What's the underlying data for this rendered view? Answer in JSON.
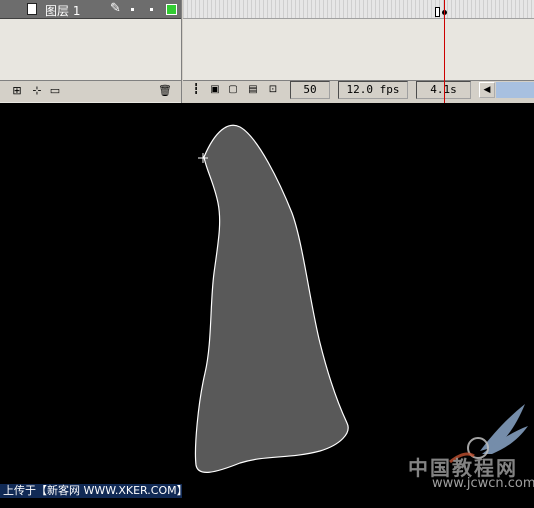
{
  "layer": {
    "name": "图层 1",
    "color": "#33cc33"
  },
  "status": {
    "current_frame": "50",
    "frame_rate": "12.0 fps",
    "elapsed_time": "4.1s"
  },
  "watermark": {
    "text": "上传于【新客网 WWW.XKER.COM】"
  },
  "logo": {
    "text_cn": "中国教程网",
    "url": "www.jcwcn.com"
  },
  "icons": {
    "insert_layer": "add-layer-icon",
    "motion_guide": "motion-guide-icon",
    "insert_folder": "folder-icon",
    "delete": "trash-icon",
    "center_frame": "center-frame-icon",
    "onion_skin": "onion-skin-icon",
    "onion_outline": "onion-outline-icon",
    "edit_multiple": "edit-multiple-frames-icon",
    "onion_markers": "onion-markers-icon"
  },
  "colors": {
    "stage_background": "#000000",
    "shape_fill": "#595959",
    "shape_stroke": "#ffffff",
    "playhead": "#cc0000",
    "timeline_background": "#d4d0c8"
  }
}
